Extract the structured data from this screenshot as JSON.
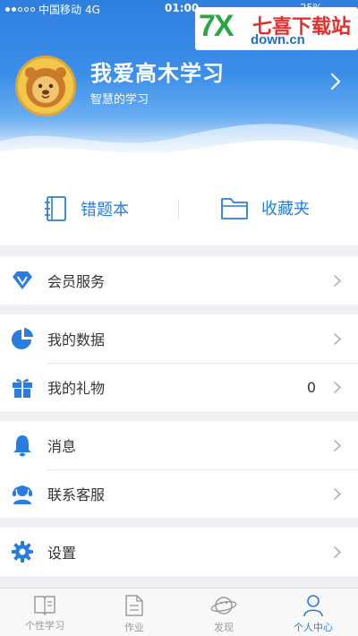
{
  "status_bar": {
    "carrier": "中国移动",
    "network": "4G",
    "time": "01:00",
    "battery": "25%"
  },
  "watermark": {
    "logo_mark": "7X",
    "logo_cn": "七喜下载站",
    "logo_en": "down.cn"
  },
  "profile": {
    "name": "我爱高木学习",
    "subtitle": "智慧的学习",
    "avatar_icon": "lion-avatar-icon"
  },
  "quick_actions": [
    {
      "label": "错题本",
      "icon": "notebook-icon"
    },
    {
      "label": "收藏夹",
      "icon": "folder-icon"
    }
  ],
  "menu": {
    "vip": {
      "label": "会员服务",
      "icon": "diamond-icon"
    },
    "my_data": {
      "label": "我的数据",
      "icon": "pie-chart-icon"
    },
    "my_gifts": {
      "label": "我的礼物",
      "icon": "gift-icon",
      "count": "0"
    },
    "messages": {
      "label": "消息",
      "icon": "bell-icon"
    },
    "customer_service": {
      "label": "联系客服",
      "icon": "headset-icon"
    },
    "settings": {
      "label": "设置",
      "icon": "gear-icon"
    }
  },
  "tabbar": [
    {
      "label": "个性学习",
      "icon": "book-icon",
      "active": false
    },
    {
      "label": "作业",
      "icon": "document-icon",
      "active": false
    },
    {
      "label": "发现",
      "icon": "planet-icon",
      "active": false
    },
    {
      "label": "个人中心",
      "icon": "person-icon",
      "active": true
    }
  ],
  "colors": {
    "accent": "#2a7de0",
    "header_top": "#2f7fe0",
    "background": "#efeff4",
    "tab_inactive": "#9a9a9a"
  }
}
